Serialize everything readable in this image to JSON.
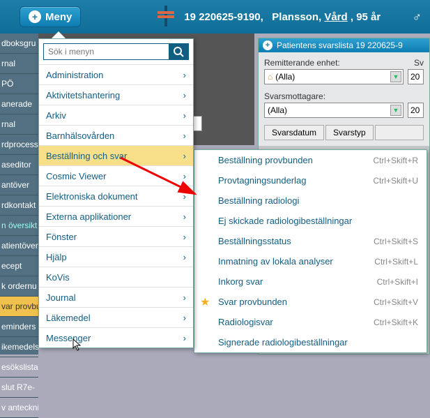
{
  "topbar": {
    "menu_label": "Meny",
    "patient_id": "19 220625-9190,",
    "patient_name": "Plansson,",
    "patient_dept": "Vård",
    "patient_age": ",  95 år",
    "gender_symbol": "♂"
  },
  "leftnav": [
    "dboksgru",
    "rnal",
    "PÖ",
    "anerade",
    "rnal",
    "rdprocess",
    "aseditor",
    "antöver",
    "rdkontakt",
    "n översikt",
    "atientövers",
    "ecept",
    "k ordernu",
    "var provbu",
    "eminders",
    "ikemedels",
    "esökslista",
    "slut R7e-",
    "v antecknin"
  ],
  "leftnav_highlight_index": 13,
  "leftnav_teal_index": 9,
  "mainmenu": {
    "search_placeholder": "Sök i menyn",
    "items": [
      {
        "label": "Administration"
      },
      {
        "label": "Aktivitetshantering"
      },
      {
        "label": "Arkiv"
      },
      {
        "label": "Barnhälsovården"
      },
      {
        "label": "Beställning och svar",
        "highlight": true
      },
      {
        "label": "Cosmic Viewer"
      },
      {
        "label": "Elektroniska dokument"
      },
      {
        "label": "Externa applikationer"
      },
      {
        "label": "Fönster"
      },
      {
        "label": "Hjälp"
      },
      {
        "label": "KoVis"
      },
      {
        "label": "Journal"
      },
      {
        "label": "Läkemedel"
      },
      {
        "label": "Messenger"
      }
    ]
  },
  "submenu": [
    {
      "label": "Beställning provbunden",
      "shortcut": "Ctrl+Skift+R"
    },
    {
      "label": "Provtagningsunderlag",
      "shortcut": "Ctrl+Skift+U"
    },
    {
      "label": "Beställning radiologi",
      "shortcut": ""
    },
    {
      "label": "Ej skickade radiologibeställningar",
      "shortcut": ""
    },
    {
      "label": "Beställningsstatus",
      "shortcut": "Ctrl+Skift+S"
    },
    {
      "label": "Inmatning av lokala analyser",
      "shortcut": "Ctrl+Skift+L"
    },
    {
      "label": "Inkorg svar",
      "shortcut": "Ctrl+Skift+I"
    },
    {
      "label": "Svar provbunden",
      "shortcut": "Ctrl+Skift+V",
      "star": true
    },
    {
      "label": "Radiologisvar",
      "shortcut": "Ctrl+Skift+K"
    },
    {
      "label": "Signerade radiologibeställningar",
      "shortcut": ""
    }
  ],
  "rightpanel": {
    "title": "Patientens svarslista 19 220625-9",
    "label1": "Remitterande enhet:",
    "label1b": "Sv",
    "select1": "(Alla)",
    "input1": "20",
    "label2": "Svarsmottagare:",
    "select2": "(Alla)",
    "input2": "20",
    "tab1": "Svarsdatum",
    "tab2": "Svarstyp"
  }
}
